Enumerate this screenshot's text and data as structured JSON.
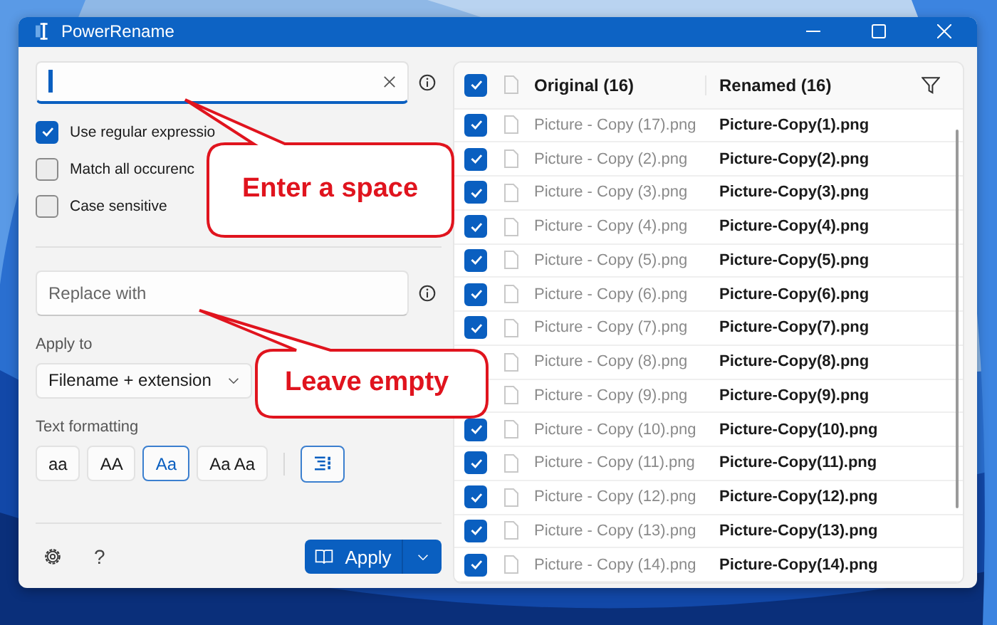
{
  "window": {
    "title": "PowerRename"
  },
  "options": [
    {
      "label": "Use regular expressio",
      "checked": true
    },
    {
      "label": "Match all occurenc",
      "checked": false
    },
    {
      "label": "Case sensitive",
      "checked": false
    }
  ],
  "replace": {
    "placeholder": "Replace with"
  },
  "apply_to": {
    "label": "Apply to",
    "value": "Filename + extension"
  },
  "text_formatting": {
    "label": "Text formatting",
    "buttons": [
      {
        "label": "aa",
        "selected": false
      },
      {
        "label": "AA",
        "selected": false
      },
      {
        "label": "Aa",
        "selected": true
      },
      {
        "label": "Aa Aa",
        "selected": false
      }
    ],
    "enumerate_selected": true
  },
  "help": "?",
  "apply_button": {
    "label": "Apply"
  },
  "table": {
    "select_all_checked": true,
    "columns": [
      "Original (16)",
      "Renamed (16)"
    ],
    "rows": [
      {
        "original": "Picture - Copy (17).png",
        "renamed": "Picture-Copy(1).png",
        "checked": true
      },
      {
        "original": "Picture - Copy (2).png",
        "renamed": "Picture-Copy(2).png",
        "checked": true
      },
      {
        "original": "Picture - Copy (3).png",
        "renamed": "Picture-Copy(3).png",
        "checked": true
      },
      {
        "original": "Picture - Copy (4).png",
        "renamed": "Picture-Copy(4).png",
        "checked": true
      },
      {
        "original": "Picture - Copy (5).png",
        "renamed": "Picture-Copy(5).png",
        "checked": true
      },
      {
        "original": "Picture - Copy (6).png",
        "renamed": "Picture-Copy(6).png",
        "checked": true
      },
      {
        "original": "Picture - Copy (7).png",
        "renamed": "Picture-Copy(7).png",
        "checked": true
      },
      {
        "original": "Picture - Copy (8).png",
        "renamed": "Picture-Copy(8).png"
      },
      {
        "original": "Picture - Copy (9).png",
        "renamed": "Picture-Copy(9).png"
      },
      {
        "original": "Picture - Copy (10).png",
        "renamed": "Picture-Copy(10).png",
        "checked": true
      },
      {
        "original": "Picture - Copy (11).png",
        "renamed": "Picture-Copy(11).png",
        "checked": true
      },
      {
        "original": "Picture - Copy (12).png",
        "renamed": "Picture-Copy(12).png",
        "checked": true
      },
      {
        "original": "Picture - Copy (13).png",
        "renamed": "Picture-Copy(13).png",
        "checked": true
      },
      {
        "original": "Picture - Copy (14).png",
        "renamed": "Picture-Copy(14).png",
        "checked": true
      }
    ]
  },
  "callouts": [
    {
      "text": "Enter a space"
    },
    {
      "text": "Leave empty"
    }
  ]
}
